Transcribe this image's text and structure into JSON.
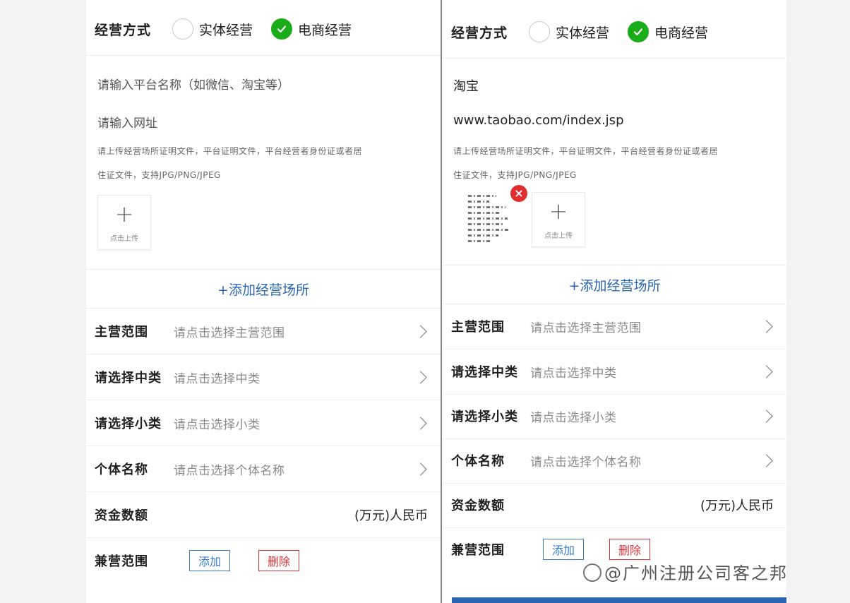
{
  "colors": {
    "accent_green": "#1aad19",
    "link_blue": "#2a66b4",
    "delete_red": "#d9343b"
  },
  "left": {
    "business_method": {
      "label": "经营方式",
      "option_physical": "实体经营",
      "option_ecommerce": "电商经营",
      "selected": "电商经营"
    },
    "platform_input": {
      "placeholder": "请输入平台名称（如微信、淘宝等）"
    },
    "url_input": {
      "placeholder": "请输入网址"
    },
    "upload_hint_line1": "请上传经营场所证明文件，平台证明文件，平台经营者身份证或者居",
    "upload_hint_line2": "住证文件，支持JPG/PNG/JPEG",
    "upload": {
      "plus": "+",
      "label": "点击上传"
    },
    "add_place": "+添加经营场所",
    "rows": [
      {
        "label": "主营范围",
        "value": "请点击选择主营范围"
      },
      {
        "label": "请选择中类",
        "value": "请点击选择中类"
      },
      {
        "label": "请选择小类",
        "value": "请点击选择小类"
      },
      {
        "label": "个体名称",
        "value": "请点击选择个体名称"
      }
    ],
    "capital": {
      "label": "资金数额",
      "unit": "(万元)人民币"
    },
    "side_scope": {
      "label": "兼营范围",
      "add": "添加",
      "delete": "删除"
    }
  },
  "right": {
    "business_method": {
      "label": "经营方式",
      "option_physical": "实体经营",
      "option_ecommerce": "电商经营",
      "selected": "电商经营"
    },
    "platform_value": "淘宝",
    "url_value": "www.taobao.com/index.jsp",
    "upload_hint_line1": "请上传经营场所证明文件，平台证明文件，平台经营者身份证或者居",
    "upload_hint_line2": "住证文件，支持JPG/PNG/JPEG",
    "thumbnail_delete": "×",
    "upload": {
      "plus": "+",
      "label": "点击上传"
    },
    "add_place": "+添加经营场所",
    "rows": [
      {
        "label": "主营范围",
        "value": "请点击选择主营范围"
      },
      {
        "label": "请选择中类",
        "value": "请点击选择中类"
      },
      {
        "label": "请选择小类",
        "value": "请点击选择小类"
      },
      {
        "label": "个体名称",
        "value": "请点击选择个体名称"
      }
    ],
    "capital": {
      "label": "资金数额",
      "unit": "(万元)人民币"
    },
    "side_scope": {
      "label": "兼营范围",
      "add": "添加",
      "delete": "删除"
    }
  },
  "watermark": "@广州注册公司客之邦"
}
